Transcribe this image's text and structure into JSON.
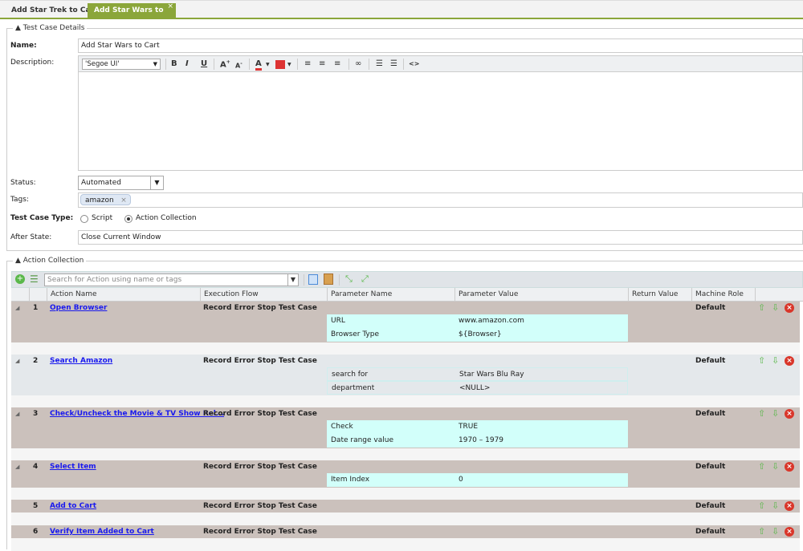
{
  "tabs": [
    {
      "label": "Add Star Trek to Cart",
      "active": false
    },
    {
      "label": "Add Star Wars to Cart",
      "active": true,
      "close": "×"
    }
  ],
  "details": {
    "legend": "Test Case Details",
    "name_label": "Name:",
    "name_value": "Add Star Wars to Cart",
    "description_label": "Description:",
    "editor_font": "'Segoe UI'",
    "status_label": "Status:",
    "status_value": "Automated",
    "tags_label": "Tags:",
    "tags": [
      "amazon"
    ],
    "type_label": "Test Case Type:",
    "type_options": [
      "Script",
      "Action Collection"
    ],
    "type_selected": "Action Collection",
    "after_state_label": "After State:",
    "after_state_value": "Close Current Window"
  },
  "actions": {
    "legend": "Action Collection",
    "search_placeholder": "Search for Action using name or tags",
    "columns": [
      "Action Name",
      "Execution Flow",
      "Parameter Name",
      "Parameter Value",
      "Return Value",
      "Machine Role"
    ],
    "rows": [
      {
        "num": "1",
        "name": "Open Browser",
        "flow": "Record Error Stop Test Case",
        "role": "Default",
        "expandable": true,
        "params": [
          [
            "URL",
            "www.amazon.com"
          ],
          [
            "Browser Type",
            "${Browser}"
          ]
        ]
      },
      {
        "num": "2",
        "name": "Search Amazon",
        "flow": "Record Error Stop Test Case",
        "role": "Default",
        "expandable": true,
        "selected": true,
        "params": [
          [
            "search for",
            "Star Wars Blu Ray"
          ],
          [
            "department",
            "<NULL>"
          ]
        ]
      },
      {
        "num": "3",
        "name": "Check/Uncheck the Movie & TV Show Rel...",
        "flow": "Record Error Stop Test Case",
        "role": "Default",
        "expandable": true,
        "params": [
          [
            "Check",
            "TRUE"
          ],
          [
            "Date range value",
            "1970 – 1979"
          ]
        ]
      },
      {
        "num": "4",
        "name": "Select Item",
        "flow": "Record Error Stop Test Case",
        "role": "Default",
        "expandable": true,
        "params": [
          [
            "Item Index",
            "0"
          ]
        ]
      },
      {
        "num": "5",
        "name": "Add to Cart",
        "flow": "Record Error Stop Test Case",
        "role": "Default",
        "expandable": false,
        "params": []
      },
      {
        "num": "6",
        "name": "Verify Item Added to Cart",
        "flow": "Record Error Stop Test Case",
        "role": "Default",
        "expandable": false,
        "params": []
      }
    ]
  },
  "colors": {
    "accent": "#8ba63a",
    "row_bg": "#cbc1bc",
    "row_selected_bg": "#e4e8eb",
    "param_bg": "#d2fffa",
    "link": "#1a1aee"
  }
}
